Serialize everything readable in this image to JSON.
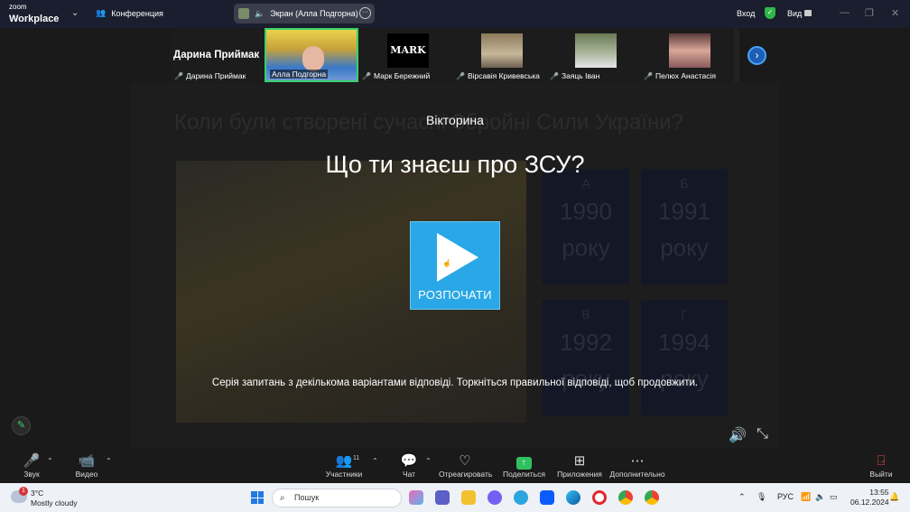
{
  "app": {
    "logo_line1": "zoom",
    "logo_line2": "Workplace",
    "conference_label": "Конференция",
    "share_label": "Экран (Алла Подгорна)",
    "signin_label": "Вход",
    "view_label": "Вид"
  },
  "participants": [
    {
      "name": "Дарина Приймак",
      "big_name": "Дарина Приймак",
      "muted": true,
      "active": false,
      "has_video": false
    },
    {
      "name": "Алла Подгорна",
      "muted": false,
      "active": true,
      "has_video": true
    },
    {
      "name": "Марк Бережний",
      "muted": true,
      "active": false,
      "has_video": true,
      "tile_text": "MARK"
    },
    {
      "name": "Вірсавія Кривевська",
      "muted": true,
      "active": false,
      "has_video": true
    },
    {
      "name": "Заяць Іван",
      "muted": true,
      "active": false,
      "has_video": true
    },
    {
      "name": "Пелюх Анастасія",
      "muted": true,
      "active": false,
      "has_video": true
    }
  ],
  "quiz": {
    "bg_question": "Коли були створені сучасні Збройні Сили України?",
    "title": "Вікторина",
    "heading": "Що ти знаєш про ЗСУ?",
    "start_label": "РОЗПОЧАТИ",
    "description": "Серія запитань з декількома варіантами відповіді. Торкніться правильної відповіді, щоб продовжити.",
    "answers": [
      {
        "letter": "А",
        "year": "1990",
        "suffix": "року"
      },
      {
        "letter": "Б",
        "year": "1991",
        "suffix": "року"
      },
      {
        "letter": "В",
        "year": "1992",
        "suffix": "року"
      },
      {
        "letter": "Г",
        "year": "1994",
        "suffix": "року"
      }
    ]
  },
  "toolbar": {
    "audio": "Звук",
    "video": "Видео",
    "participants": "Участники",
    "participants_count": "11",
    "chat": "Чат",
    "react": "Отреагировать",
    "share": "Поделиться",
    "apps": "Приложения",
    "more": "Дополнительно",
    "leave": "Выйти"
  },
  "taskbar": {
    "temp": "3°C",
    "weather": "Mostly cloudy",
    "weather_badge": "1",
    "search_placeholder": "Пошук",
    "lang": "РУС",
    "time": "13:55",
    "date": "06.12.2024"
  },
  "colors": {
    "accent_blue": "#2aa7e6",
    "active_green": "#3ad16b",
    "muted_red": "#e0443e"
  }
}
